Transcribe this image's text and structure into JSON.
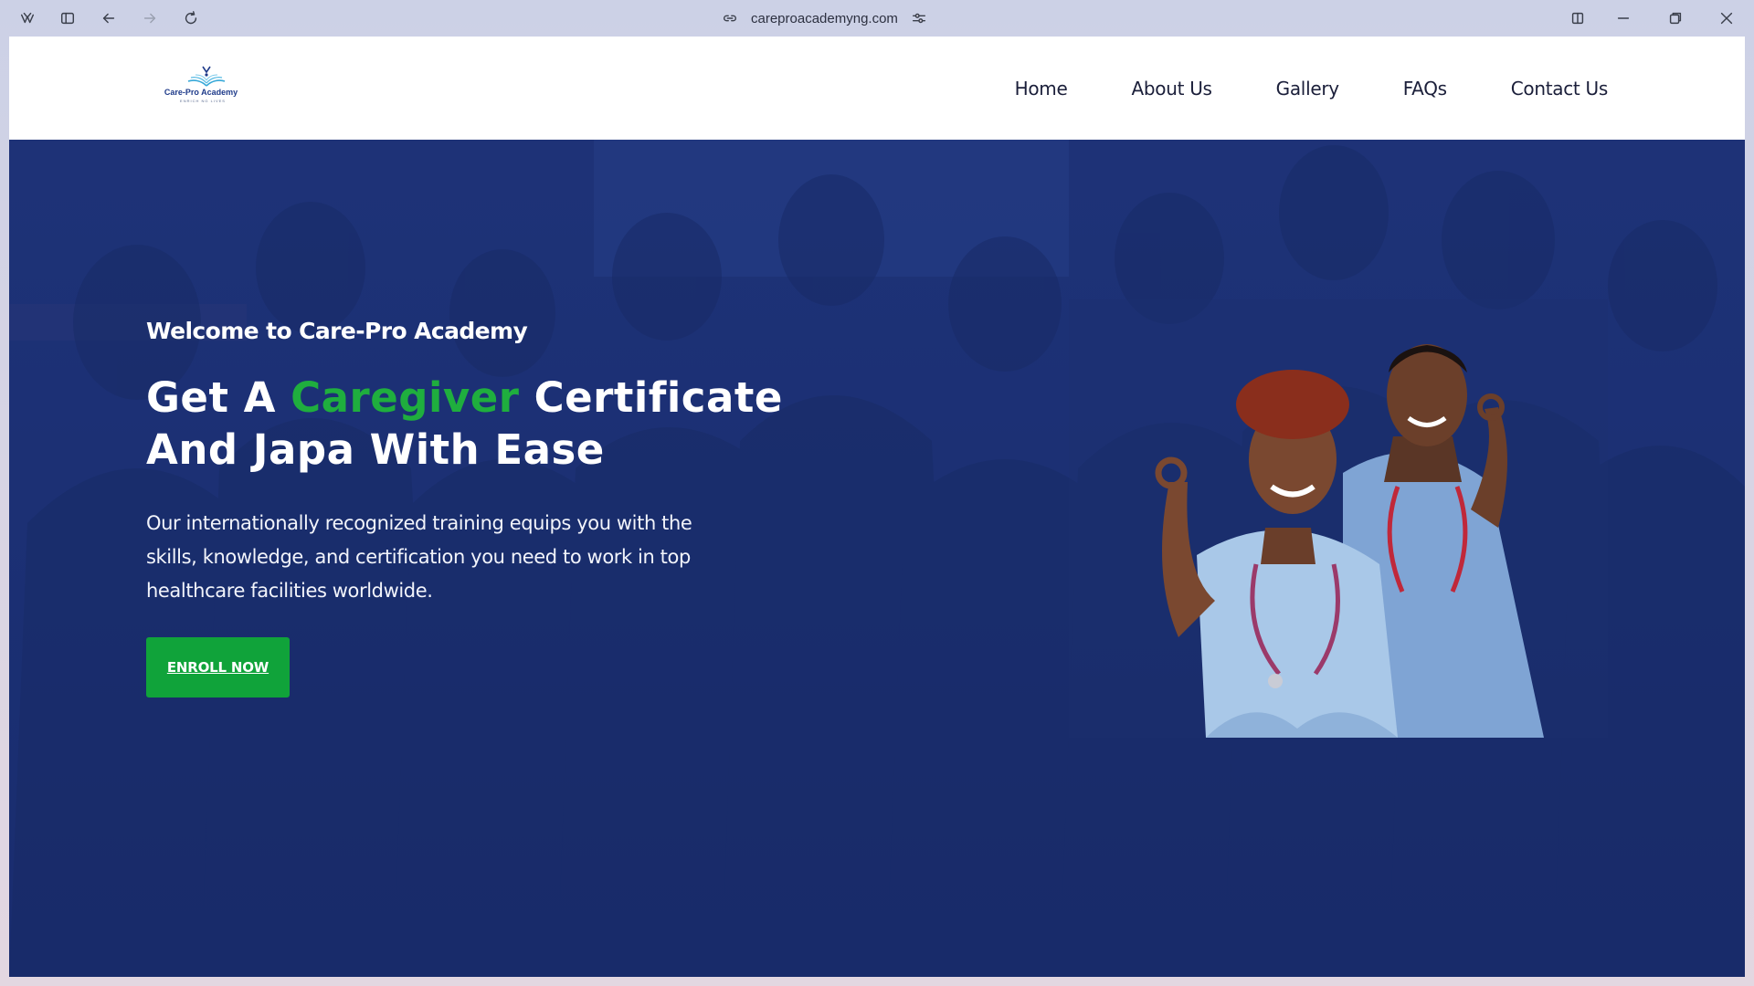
{
  "browser": {
    "url": "careproacademyng.com",
    "icons": {
      "menu": "copilot-icon",
      "sidebar": "sidebar-toggle-icon",
      "back": "back-arrow-icon",
      "forward": "forward-arrow-icon",
      "reload": "reload-icon",
      "site_info": "link-icon",
      "site_settings": "tune-icon",
      "split": "split-screen-icon",
      "minimize": "minimize-icon",
      "restore": "restore-icon",
      "close": "close-icon"
    }
  },
  "header": {
    "logo": {
      "name": "Care-Pro Academy",
      "tagline": "ENRICH NG LIVES"
    },
    "nav": [
      {
        "label": "Home"
      },
      {
        "label": "About Us"
      },
      {
        "label": "Gallery"
      },
      {
        "label": "FAQs"
      },
      {
        "label": "Contact Us"
      }
    ]
  },
  "hero": {
    "welcome": "Welcome to Care-Pro Academy",
    "headline": {
      "part1": "Get A ",
      "accent": "Caregiver",
      "part2": " Certificate And Japa With Ease"
    },
    "description": "Our internationally recognized training equips you with the skills, knowledge, and certification you need to work in top healthcare facilities worldwide.",
    "cta": "ENROLL NOW"
  },
  "colors": {
    "brand_blue": "#1f3479",
    "accent_green": "#1fae3e",
    "button_green": "#10a33a",
    "scrubs_light": "#a9c8e8"
  }
}
